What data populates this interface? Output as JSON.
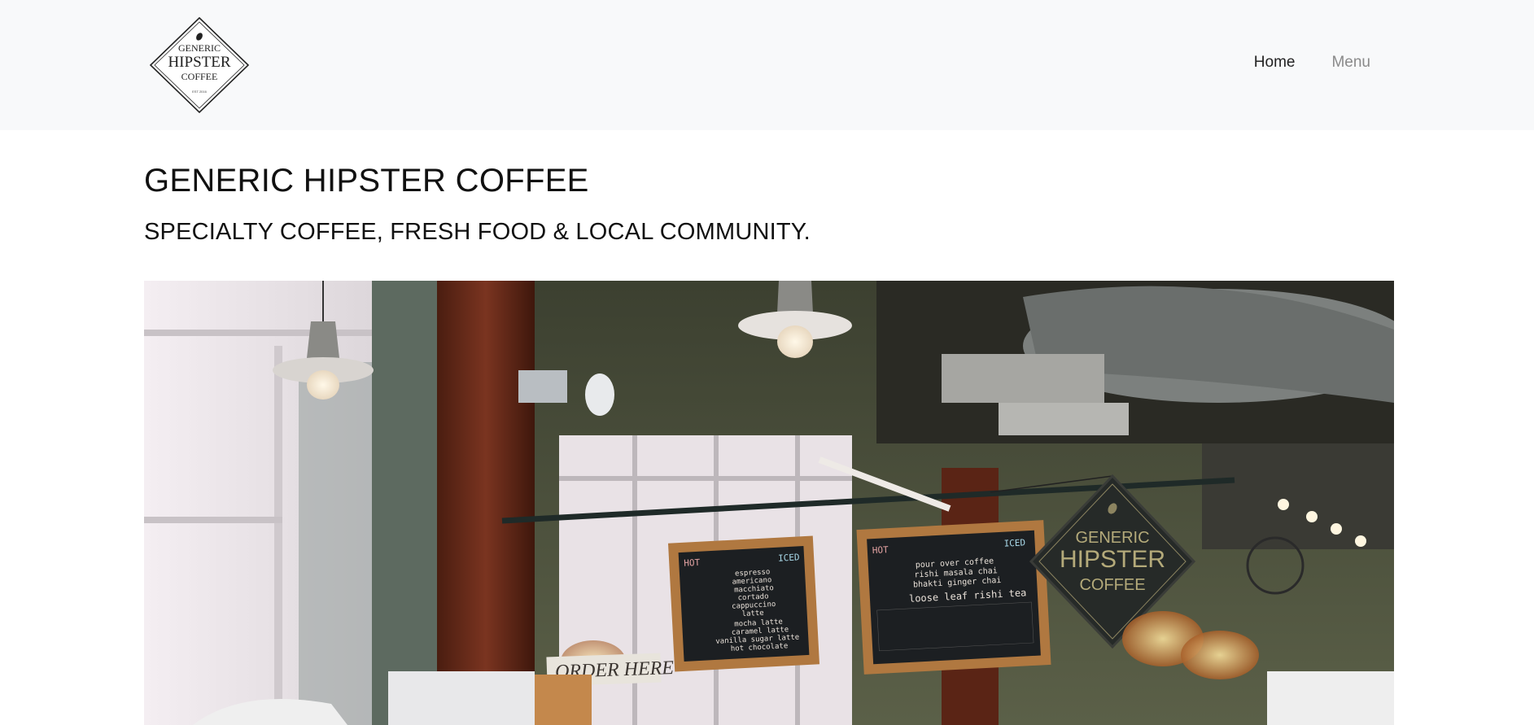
{
  "logo": {
    "line1": "GENERIC",
    "line2": "HIPSTER",
    "line3": "COFFEE",
    "line4": "EST 2016"
  },
  "nav": {
    "items": [
      {
        "label": "Home",
        "active": true
      },
      {
        "label": "Menu",
        "active": false
      }
    ]
  },
  "hero": {
    "title": "GENERIC HIPSTER COFFEE",
    "subtitle": "SPECIALTY COFFEE, FRESH FOOD & LOCAL COMMUNITY."
  },
  "photo": {
    "board1": {
      "heading_left": "HOT",
      "heading_right": "ICED",
      "items": [
        "espresso",
        "americano",
        "macchiato",
        "cortado",
        "cappuccino",
        "latte",
        "mocha latte",
        "caramel latte",
        "vanilla sugar latte",
        "hot chocolate"
      ]
    },
    "board2": {
      "heading_left": "HOT",
      "heading_right": "ICED",
      "items": [
        "pour over coffee",
        "rishi masala chai",
        "bhakti ginger chai",
        "loose leaf rishi tea"
      ]
    },
    "sign": {
      "line1": "GENERIC",
      "line2": "HIPSTER",
      "line3": "COFFEE"
    },
    "order_sign": "ORDER HERE"
  },
  "colors": {
    "navbar_bg": "#f8f9fa",
    "nav_active": "#222222",
    "nav_inactive": "#8a8a8a"
  }
}
